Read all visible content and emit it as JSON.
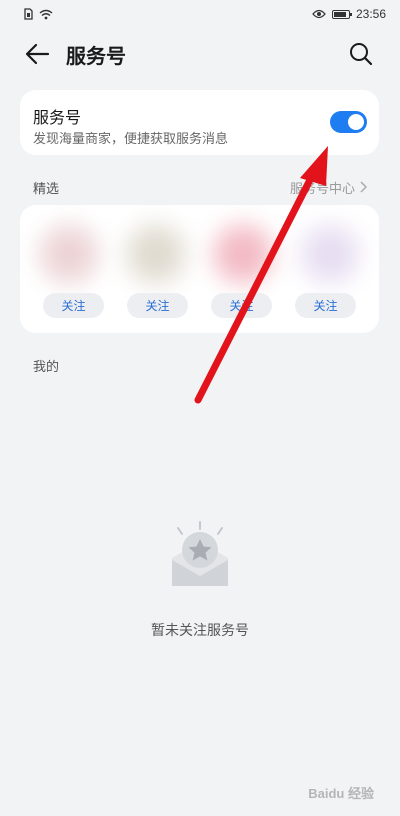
{
  "status_bar": {
    "time": "23:56",
    "battery_level": 0.9
  },
  "header": {
    "title": "服务号"
  },
  "toggle_card": {
    "title": "服务号",
    "subtitle": "发现海量商家，便捷获取服务消息",
    "enabled": true
  },
  "featured": {
    "section_label": "精选",
    "center_link": "服务号中心",
    "accounts": [
      {
        "follow_label": "关注",
        "tint": "#e8c9cb"
      },
      {
        "follow_label": "关注",
        "tint": "#d9d2c4"
      },
      {
        "follow_label": "关注",
        "tint": "#f0a9b6"
      },
      {
        "follow_label": "关注",
        "tint": "#e1d6ee"
      }
    ]
  },
  "mine": {
    "section_label": "我的",
    "empty_text": "暂未关注服务号"
  },
  "watermark": "Baidu 经验",
  "colors": {
    "accent": "#1f7df2",
    "annotation_arrow": "#e3131b"
  },
  "icons": [
    "back-arrow-icon",
    "search-icon",
    "chevron-right-icon",
    "empty-star-mailbox-icon",
    "wifi-icon",
    "eye-icon",
    "battery-icon",
    "sim-icon"
  ]
}
